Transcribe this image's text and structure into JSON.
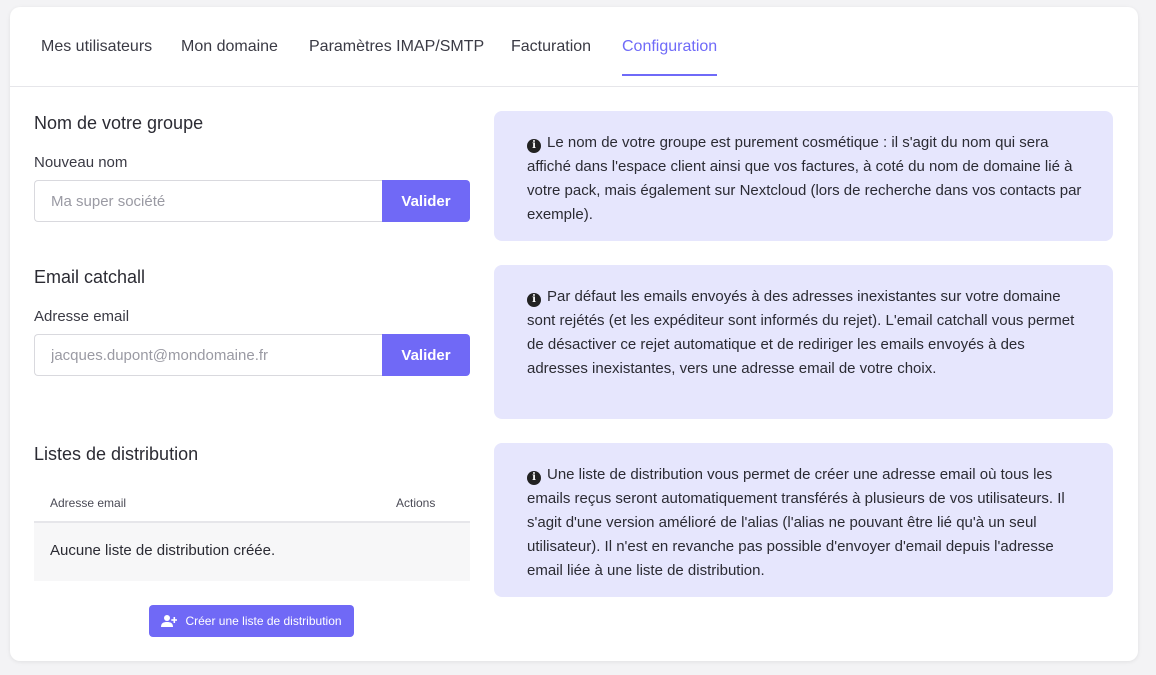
{
  "tabs": [
    {
      "label": "Mes utilisateurs",
      "active": false
    },
    {
      "label": "Mon domaine",
      "active": false
    },
    {
      "label": "Paramètres IMAP/SMTP",
      "active": false
    },
    {
      "label": "Facturation",
      "active": false
    },
    {
      "label": "Configuration",
      "active": true
    }
  ],
  "group": {
    "title": "Nom de votre groupe",
    "field_label": "Nouveau nom",
    "placeholder": "Ma super société",
    "value": "",
    "button": "Valider",
    "info": "Le nom de votre groupe est purement cosmétique : il s'agit du nom qui sera affiché dans l'espace client ainsi que vos factures, à coté du nom de domaine lié à votre pack, mais également sur Nextcloud (lors de recherche dans vos contacts par exemple)."
  },
  "catchall": {
    "title": "Email catchall",
    "field_label": "Adresse email",
    "placeholder": "jacques.dupont@mondomaine.fr",
    "value": "",
    "button": "Valider",
    "info": "Par défaut les emails envoyés à des adresses inexistantes sur votre domaine sont rejétés (et les expéditeur sont informés du rejet). L'email catchall vous permet de désactiver ce rejet automatique et de rediriger les emails envoyés à des adresses inexistantes, vers une adresse email de votre choix."
  },
  "distribution": {
    "title": "Listes de distribution",
    "columns": [
      "Adresse email",
      "Actions"
    ],
    "empty": "Aucune liste de distribution créée.",
    "create_button": "Créer une liste de distribution",
    "info": "Une liste de distribution vous permet de créer une adresse email où tous les emails reçus seront automatiquement transférés à plusieurs de vos utilisateurs. Il s'agit d'une version amélioré de l'alias (l'alias ne pouvant être lié qu'à un seul utilisateur). Il n'est en revanche pas possible d'envoyer d'email depuis l'adresse email liée à une liste de distribution."
  },
  "icons": {
    "info": "info-circle-icon",
    "create": "user-plus-icon"
  },
  "colors": {
    "accent": "#7069f6",
    "info_bg": "#e6e6fd"
  }
}
